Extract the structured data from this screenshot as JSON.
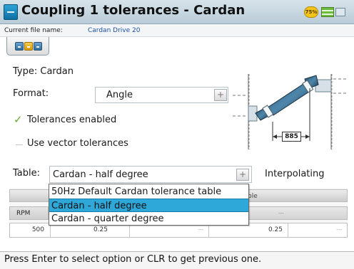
{
  "window": {
    "title": "Coupling 1 tolerances - Cardan",
    "battery_badge_text": "75%"
  },
  "file": {
    "label": "Current file name:",
    "name": "Cardan Drive 20"
  },
  "form": {
    "type_label": "Type: Cardan",
    "format_label": "Format:",
    "format_value": "Angle",
    "tolerances_enabled": {
      "label": "Tolerances enabled",
      "checked": true
    },
    "vector_tolerances": {
      "label": "Use vector tolerances",
      "checked": false
    },
    "table_label": "Table:",
    "table_value": "Cardan - half degree",
    "interpolating_label": "Interpolating"
  },
  "dropdown": {
    "options": [
      "50Hz Default Cardan tolerance table",
      "Cardan - half degree",
      "Cardan - quarter degree"
    ],
    "selected": "Cardan - half degree"
  },
  "tolerance_table": {
    "header_partial": "ble",
    "rpm_header": "RPM",
    "column_placeholder": "---",
    "row": {
      "rpm": "500",
      "values": [
        "0.25",
        "---",
        "0.25",
        "---"
      ]
    }
  },
  "diagram": {
    "distance": "885",
    "icon_name": "cardan-coupling-diagram"
  },
  "status": {
    "message": "Press Enter to select option or CLR to get previous one."
  },
  "colors": {
    "selection": "#2ea7d9",
    "check": "#65a832",
    "title_bar": "#c8d8e2"
  }
}
